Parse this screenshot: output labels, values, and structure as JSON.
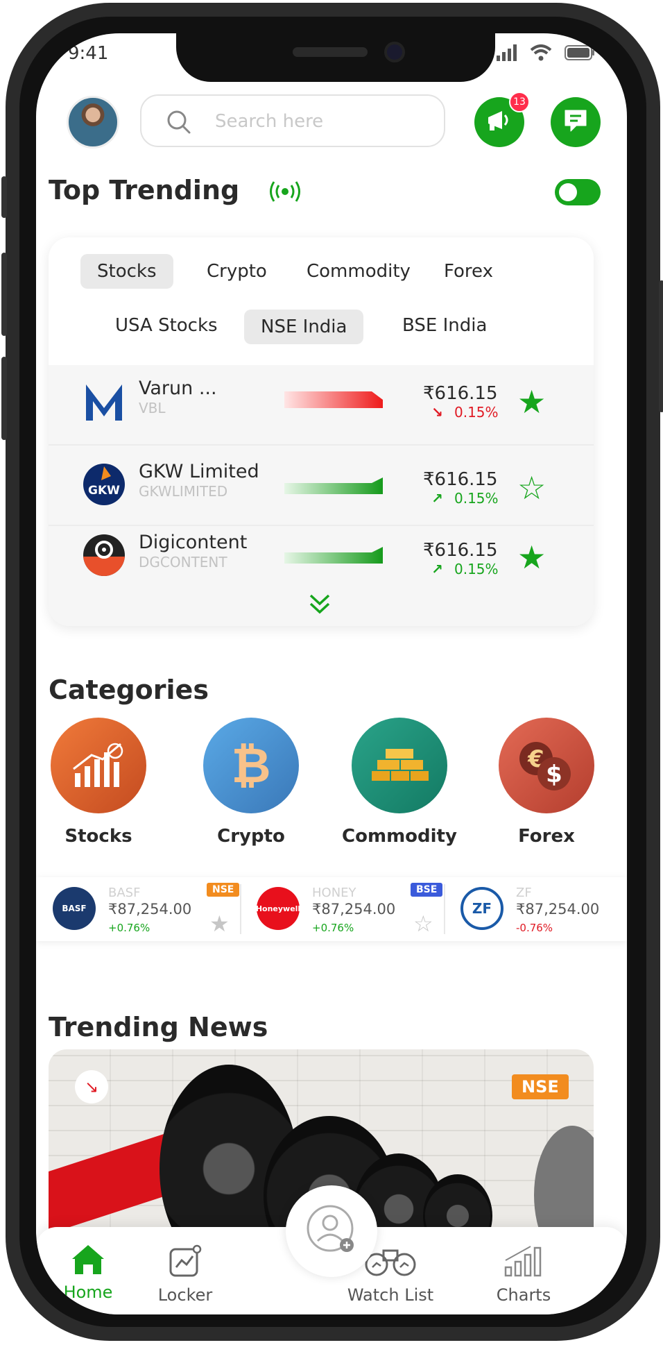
{
  "status_bar": {
    "time": "9:41"
  },
  "header": {
    "search_placeholder": "Search here",
    "notification_count": "13"
  },
  "trending": {
    "title": "Top Trending",
    "live_toggle_on": true,
    "asset_tabs": [
      "Stocks",
      "Crypto",
      "Commodity",
      "Forex"
    ],
    "active_asset_tab": "Stocks",
    "market_tabs": [
      "USA Stocks",
      "NSE India",
      "BSE India"
    ],
    "active_market_tab": "NSE India",
    "rows": [
      {
        "name": "Varun ...",
        "symbol": "VBL",
        "price": "₹616.15",
        "change": "0.15%",
        "direction": "down",
        "starred": true
      },
      {
        "name": "GKW Limited",
        "symbol": "GKWLIMITED",
        "price": "₹616.15",
        "change": "0.15%",
        "direction": "up",
        "starred": false
      },
      {
        "name": "Digicontent",
        "symbol": "DGCONTENT",
        "price": "₹616.15",
        "change": "0.15%",
        "direction": "up",
        "starred": true
      }
    ]
  },
  "categories": {
    "title": "Categories",
    "items": [
      {
        "label": "Stocks",
        "icon": "stocks-chart-icon"
      },
      {
        "label": "Crypto",
        "icon": "bitcoin-icon"
      },
      {
        "label": "Commodity",
        "icon": "gold-bars-icon"
      },
      {
        "label": "Forex",
        "icon": "currency-exchange-icon"
      }
    ]
  },
  "ticker": [
    {
      "name": "BASF",
      "logo_text": "BASF",
      "price": "₹87,254.00",
      "change": "+0.76%",
      "exchange": "NSE",
      "exchange_color": "#f28c1f",
      "change_color": "#17a51d"
    },
    {
      "name": "HONEY",
      "logo_text": "Honeywell",
      "price": "₹87,254.00",
      "change": "+0.76%",
      "exchange": "BSE",
      "exchange_color": "#3b5bdb",
      "change_color": "#17a51d"
    },
    {
      "name": "ZF",
      "logo_text": "ZF",
      "price": "₹87,254.00",
      "change": "-0.76%",
      "exchange": "",
      "exchange_color": "",
      "change_color": "#e01a24"
    }
  ],
  "news": {
    "title": "Trending News",
    "badge": "NSE"
  },
  "tabbar": {
    "items": [
      "Home",
      "Locker",
      "Watch List",
      "Charts"
    ],
    "active": "Home"
  },
  "colors": {
    "accent": "#17a51d",
    "down": "#e01a24",
    "badge": "#ff2d4b"
  }
}
